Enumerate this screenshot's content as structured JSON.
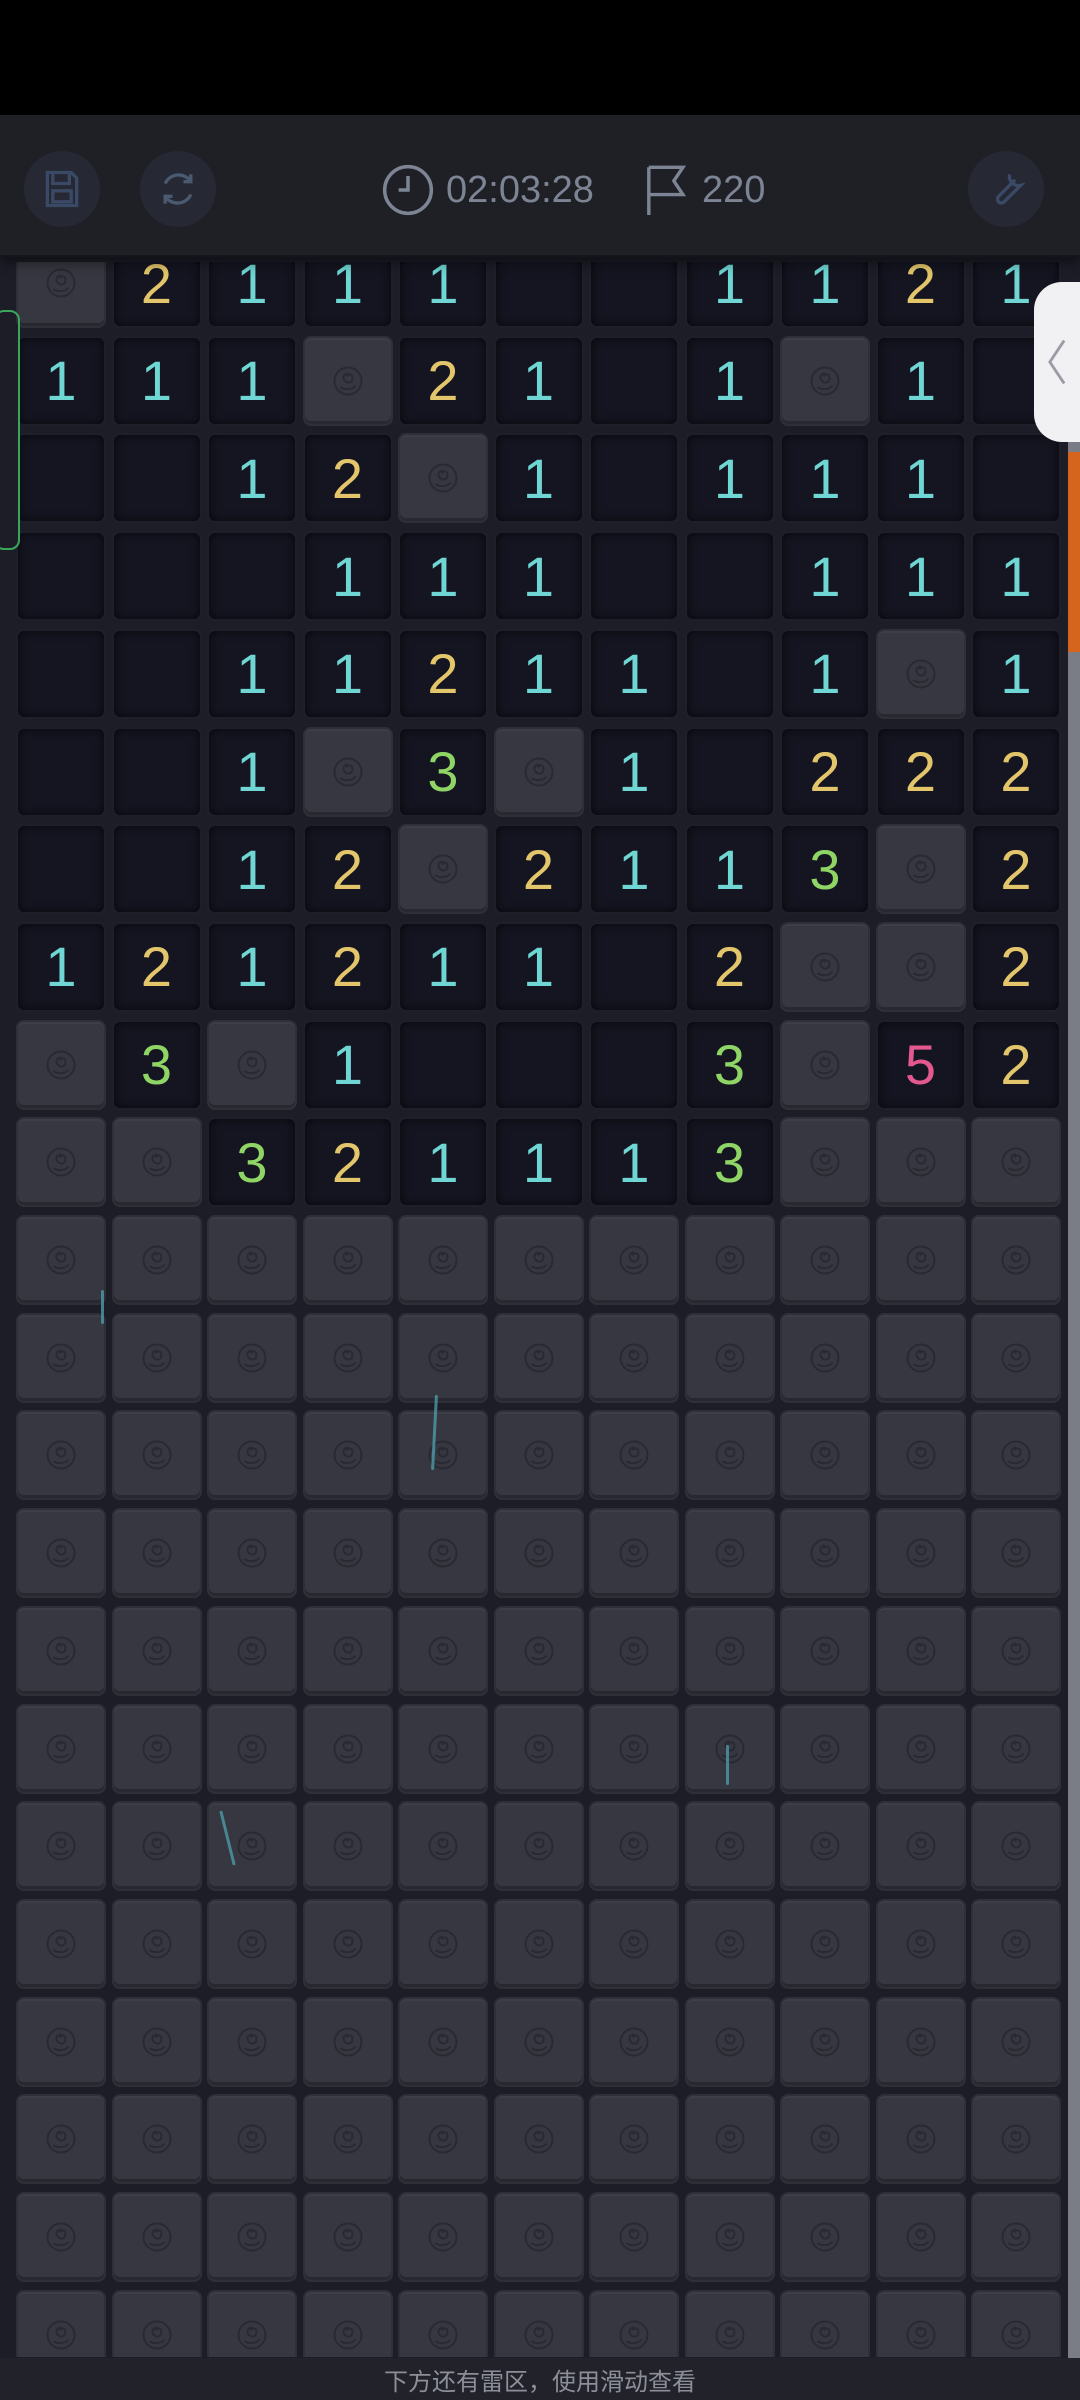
{
  "topbar": {
    "timer": "02:03:28",
    "flags": "220",
    "icons": [
      "save-icon",
      "refresh-icon",
      "clock-icon",
      "flag-icon",
      "wrench-icon"
    ]
  },
  "board": {
    "columns": 11,
    "visible_rows": 22,
    "legend": "H = hidden tile, . = revealed empty, digit = revealed number",
    "rows": [
      [
        "H",
        "2",
        "1",
        "1",
        "1",
        ".",
        ".",
        "1",
        "1",
        "2",
        "1"
      ],
      [
        "1",
        "1",
        "1",
        "H",
        "2",
        "1",
        ".",
        "1",
        "H",
        "1",
        "."
      ],
      [
        ".",
        ".",
        "1",
        "2",
        "H",
        "1",
        ".",
        "1",
        "1",
        "1",
        "."
      ],
      [
        ".",
        ".",
        ".",
        "1",
        "1",
        "1",
        ".",
        ".",
        "1",
        "1",
        "1"
      ],
      [
        ".",
        ".",
        "1",
        "1",
        "2",
        "1",
        "1",
        ".",
        "1",
        "H",
        "1"
      ],
      [
        ".",
        ".",
        "1",
        "H",
        "3",
        "H",
        "1",
        ".",
        "2",
        "2",
        "2"
      ],
      [
        ".",
        ".",
        "1",
        "2",
        "H",
        "2",
        "1",
        "1",
        "3",
        "H",
        "2"
      ],
      [
        "1",
        "2",
        "1",
        "2",
        "1",
        "1",
        ".",
        "2",
        "H",
        "H",
        "2"
      ],
      [
        "H",
        "3",
        "H",
        "1",
        ".",
        ".",
        ".",
        "3",
        "H",
        "5",
        "2"
      ],
      [
        "H",
        "H",
        "3",
        "2",
        "1",
        "1",
        "1",
        "3",
        "H",
        "H",
        "H"
      ],
      [
        "H",
        "H",
        "H",
        "H",
        "H",
        "H",
        "H",
        "H",
        "H",
        "H",
        "H"
      ],
      [
        "H",
        "H",
        "H",
        "H",
        "H",
        "H",
        "H",
        "H",
        "H",
        "H",
        "H"
      ],
      [
        "H",
        "H",
        "H",
        "H",
        "H",
        "H",
        "H",
        "H",
        "H",
        "H",
        "H"
      ],
      [
        "H",
        "H",
        "H",
        "H",
        "H",
        "H",
        "H",
        "H",
        "H",
        "H",
        "H"
      ],
      [
        "H",
        "H",
        "H",
        "H",
        "H",
        "H",
        "H",
        "H",
        "H",
        "H",
        "H"
      ],
      [
        "H",
        "H",
        "H",
        "H",
        "H",
        "H",
        "H",
        "H",
        "H",
        "H",
        "H"
      ],
      [
        "H",
        "H",
        "H",
        "H",
        "H",
        "H",
        "H",
        "H",
        "H",
        "H",
        "H"
      ],
      [
        "H",
        "H",
        "H",
        "H",
        "H",
        "H",
        "H",
        "H",
        "H",
        "H",
        "H"
      ],
      [
        "H",
        "H",
        "H",
        "H",
        "H",
        "H",
        "H",
        "H",
        "H",
        "H",
        "H"
      ],
      [
        "H",
        "H",
        "H",
        "H",
        "H",
        "H",
        "H",
        "H",
        "H",
        "H",
        "H"
      ],
      [
        "H",
        "H",
        "H",
        "H",
        "H",
        "H",
        "H",
        "H",
        "H",
        "H",
        "H"
      ],
      [
        "H",
        "H",
        "H",
        "H",
        "H",
        "H",
        "H",
        "H",
        "H",
        "H",
        "H"
      ]
    ],
    "number_colors": {
      "1": "#6fd6d4",
      "2": "#e3c66b",
      "3": "#8fd566",
      "5": "#e3588e"
    },
    "hidden_tile_icon": "rose-icon"
  },
  "hint": "下方还有雷区，使用滑动查看",
  "side_handle_icon": "chevron-left-icon"
}
